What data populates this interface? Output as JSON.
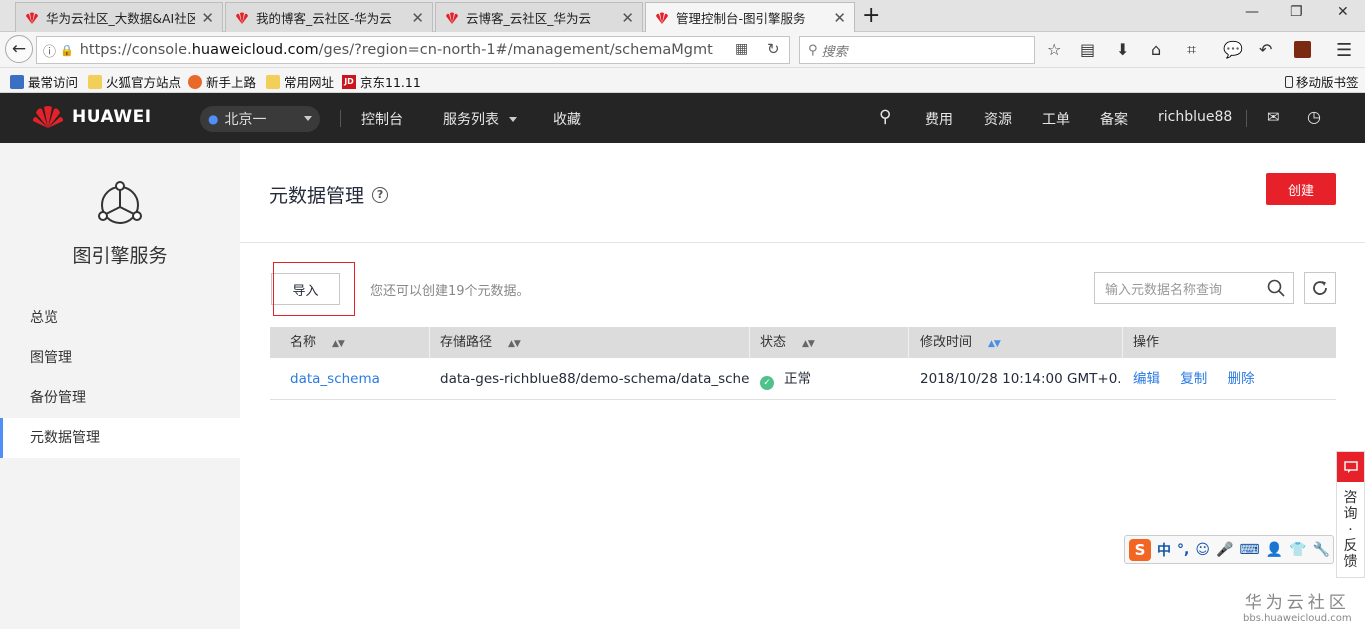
{
  "browser": {
    "tabs": [
      {
        "label": "华为云社区_大数据&AI社区_"
      },
      {
        "label": "我的博客_云社区-华为云"
      },
      {
        "label": "云博客_云社区_华为云"
      },
      {
        "label": "管理控制台-图引擎服务"
      }
    ],
    "url_prefix": "https://console.",
    "url_host": "huaweicloud.com",
    "url_rest": "/ges/?region=cn-north-1#/management/schemaMgmt",
    "search_placeholder": "搜索",
    "bookmarks": [
      {
        "label": "最常访问"
      },
      {
        "label": "火狐官方站点"
      },
      {
        "label": "新手上路"
      },
      {
        "label": "常用网址"
      },
      {
        "label": "京东11.11"
      }
    ],
    "mobile_bookmarks": "移动版书签"
  },
  "header": {
    "logo": "HUAWEI",
    "region": "北京一",
    "console": "控制台",
    "services": "服务列表",
    "favorites": "收藏",
    "fees": "费用",
    "resources": "资源",
    "tickets": "工单",
    "filing": "备案",
    "username": "richblue88"
  },
  "sidebar": {
    "service_name": "图引擎服务",
    "items": [
      {
        "label": "总览"
      },
      {
        "label": "图管理"
      },
      {
        "label": "备份管理"
      },
      {
        "label": "元数据管理"
      }
    ]
  },
  "main": {
    "title": "元数据管理",
    "create_label": "创建",
    "import_label": "导入",
    "hint": "您还可以创建19个元数据。",
    "search_placeholder": "输入元数据名称查询",
    "columns": [
      "名称",
      "存储路径",
      "状态",
      "修改时间",
      "操作"
    ],
    "rows": [
      {
        "name": "data_schema",
        "path": "data-ges-richblue88/demo-schema/data_sche...",
        "status": "正常",
        "modified": "2018/10/28 10:14:00 GMT+0...",
        "actions": [
          "编辑",
          "复制",
          "删除"
        ]
      }
    ]
  },
  "widget": {
    "consult": [
      "咨",
      "询",
      "·",
      "反",
      "馈"
    ],
    "ime": "中"
  },
  "watermark": {
    "line1": "华为云社区",
    "line2": "bbs.huaweicloud.com"
  },
  "colors": {
    "accent_red": "#e6212a",
    "link_blue": "#2a7ae2",
    "status_green": "#50c18a",
    "header_bg": "#252525"
  }
}
